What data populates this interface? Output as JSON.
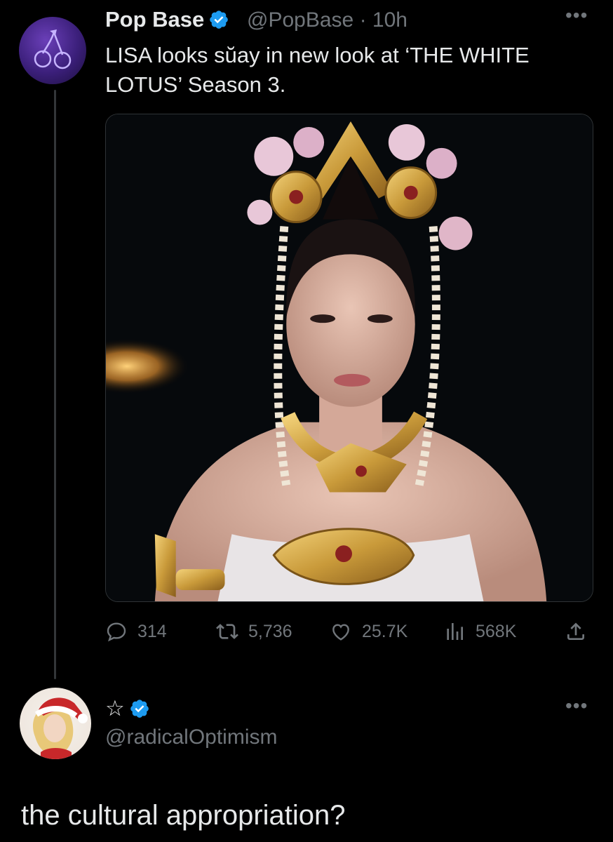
{
  "tweet": {
    "author_name": "Pop Base",
    "handle": "@PopBase",
    "separator": "·",
    "time": "10h",
    "text": "LISA looks sŭay in new look at ‘THE WHITE LOTUS’ Season 3.",
    "media_image": "woman-in-thai-golden-headdress-and-jewelry",
    "actions": {
      "replies": "314",
      "retweets": "5,736",
      "likes": "25.7K",
      "views": "568K"
    }
  },
  "reply": {
    "author_name": "☆",
    "handle": "@radicalOptimism",
    "text": "the cultural appropriation?"
  },
  "colors": {
    "background": "#000000",
    "text": "#e7e9ea",
    "muted": "#71767b",
    "verified": "#1d9bf0"
  },
  "icons": [
    "cherry-icon",
    "verified-badge-icon",
    "more-icon",
    "reply-icon",
    "retweet-icon",
    "like-icon",
    "views-icon",
    "share-icon"
  ]
}
